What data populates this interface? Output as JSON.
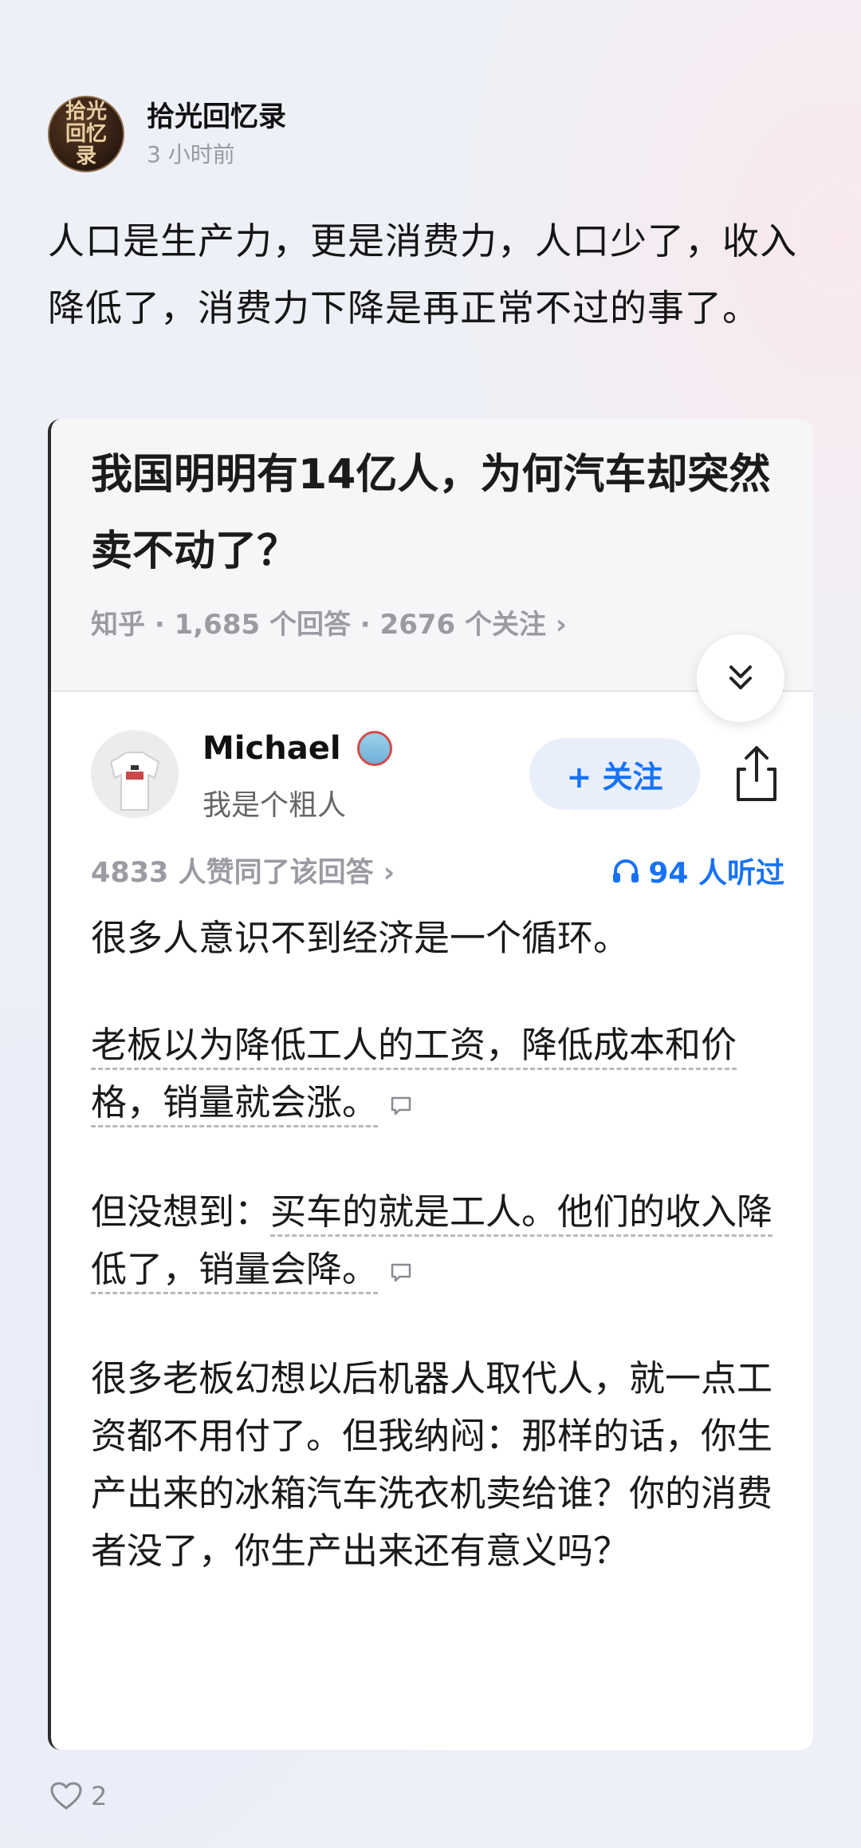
{
  "post": {
    "author": "拾光回忆录",
    "avatar_text": "拾光回忆录",
    "time": "3 小时前",
    "text": "人口是生产力，更是消费力，人口少了，收入降低了，消费力下降是再正常不过的事了。",
    "likes": "2"
  },
  "card": {
    "question_title": "我国明明有14亿人，为何汽车却突然卖不动了？",
    "meta": "知乎 · 1,685 个回答 · 2676 个关注 ›",
    "answerer_name": "Michael",
    "answerer_bio": "我是个粗人",
    "follow_label": "+ 关注",
    "votes": "4833 人赞同了该回答 ›",
    "listened": "94 人听过",
    "paragraphs": {
      "p1": "很多人意识不到经济是一个循环。",
      "p2": "老板以为降低工人的工资，降低成本和价格，销量就会涨。",
      "p3a": "但没想到：",
      "p3b": "买车的就是工人。他们的收入降低了，销量会降。",
      "p4": "很多老板幻想以后机器人取代人，就一点工资都不用付了。但我纳闷：那样的话，你生产出来的冰箱汽车洗衣机卖给谁？你的消费者没了，你生产出来还有意义吗？"
    }
  },
  "icons": {
    "collapse": "double-chevron-down-icon",
    "share": "share-icon",
    "headphones": "headphones-icon",
    "comment": "comment-icon",
    "like": "heart-icon"
  },
  "colors": {
    "accent_blue": "#1772f6",
    "follow_bg": "#e9eefb",
    "page_bg": "#eef0f7"
  }
}
